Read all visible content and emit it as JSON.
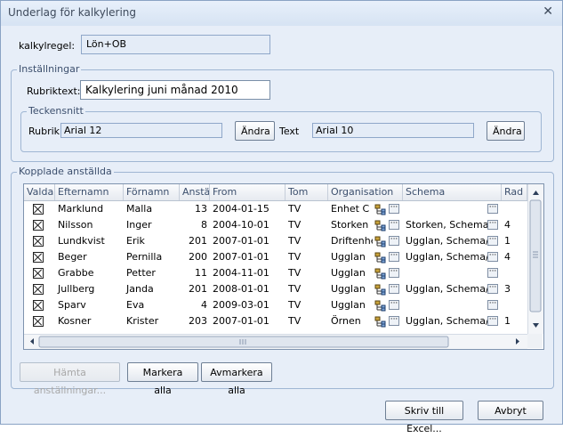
{
  "window": {
    "title": "Underlag för kalkylering"
  },
  "form": {
    "kalkylregel_label": "kalkylregel:",
    "kalkylregel_value": "Lön+OB",
    "installningar_title": "Inställningar",
    "rubriktext_label": "Rubriktext:",
    "rubriktext_value": "Kalkylering juni månad 2010",
    "teckensnitt_title": "Teckensnitt",
    "rubrik_label": "Rubrik",
    "rubrik_font": "Arial 12",
    "andra_label": "Ändra",
    "text_label": "Text",
    "text_font": "Arial 10"
  },
  "grid": {
    "group_title": "Kopplade anställda",
    "columns": [
      "Valda",
      "Efternamn",
      "Förnamn",
      "Anställ",
      "From",
      "Tom",
      "Organisation",
      "Schema",
      "Rad"
    ],
    "rows": [
      [
        "Marklund",
        "Malla",
        "13",
        "2004-01-15",
        "TV",
        "Enhet C",
        "",
        ""
      ],
      [
        "Nilsson",
        "Inger",
        "8",
        "2004-10-01",
        "TV",
        "Storken",
        "Storken, Schema/",
        "4"
      ],
      [
        "Lundkvist",
        "Erik",
        "201",
        "2007-01-01",
        "TV",
        "Driftenhe",
        "Ugglan, Schema/",
        "1"
      ],
      [
        "Beger",
        "Pernilla",
        "200",
        "2007-01-01",
        "TV",
        "Ugglan",
        "Ugglan, Schema/",
        "4"
      ],
      [
        "Grabbe",
        "Petter",
        "11",
        "2004-11-01",
        "TV",
        "Ugglan",
        "",
        ""
      ],
      [
        "Jullberg",
        "Janda",
        "201",
        "2008-01-01",
        "TV",
        "Ugglan",
        "Ugglan, Schema/",
        "3"
      ],
      [
        "Sparv",
        "Eva",
        "4",
        "2009-03-01",
        "TV",
        "Ugglan",
        "",
        ""
      ],
      [
        "Kosner",
        "Krister",
        "203",
        "2007-01-01",
        "TV",
        "Örnen",
        "Ugglan, Schema/",
        "1"
      ]
    ]
  },
  "buttons": {
    "hamta": "Hämta anställningar...",
    "markera_alla": "Markera alla",
    "avmarkera_alla": "Avmarkera alla",
    "skriv_excel": "Skriv till Excel...",
    "avbryt": "Avbryt"
  }
}
